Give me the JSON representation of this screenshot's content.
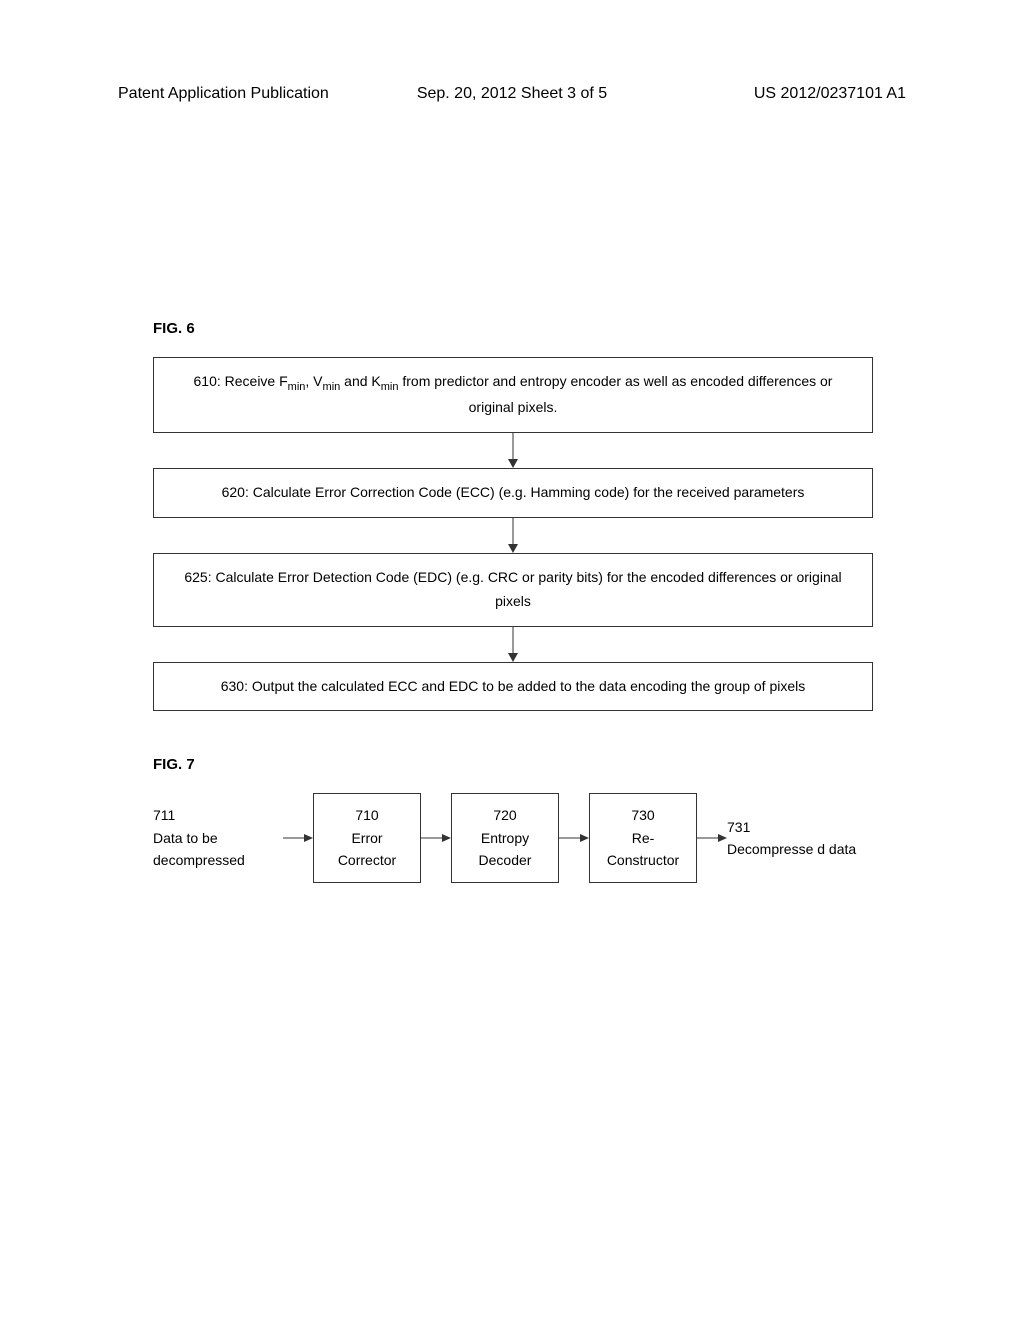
{
  "header": {
    "left": "Patent Application Publication",
    "center": "Sep. 20, 2012  Sheet 3 of 5",
    "right": "US 2012/0237101 A1"
  },
  "fig6": {
    "label": "FIG. 6",
    "box610_prefix": "610: Receive F",
    "box610_sub1": "min",
    "box610_mid1": ", V",
    "box610_sub2": "min",
    "box610_mid2": " and K",
    "box610_sub3": "min",
    "box610_suffix": " from predictor and entropy encoder as well as encoded differences or original pixels.",
    "box620": "620: Calculate Error Correction Code (ECC) (e.g. Hamming code) for the received parameters",
    "box625": "625: Calculate Error Detection Code (EDC) (e.g. CRC or parity bits) for the encoded differences or original pixels",
    "box630": "630: Output the calculated ECC and EDC to be added to the data encoding the group of pixels"
  },
  "fig7": {
    "label": "FIG. 7",
    "input_num": "711",
    "input_text": "Data to be decompressed",
    "box710_num": "710",
    "box710_text": "Error Corrector",
    "box720_num": "720",
    "box720_text": "Entropy Decoder",
    "box730_num": "730",
    "box730_text": "Re-Constructor",
    "output_num": "731",
    "output_text": "Decompresse d data"
  }
}
